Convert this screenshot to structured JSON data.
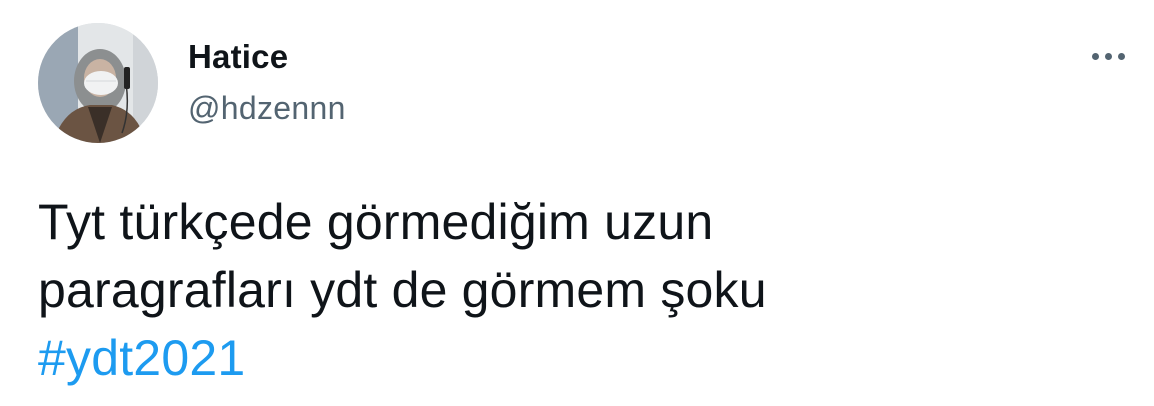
{
  "tweet": {
    "author": {
      "display_name": "Hatice",
      "handle": "@hdzennn"
    },
    "more_icon": "more-horizontal-icon",
    "text_lines": [
      "Tyt türkçede görmediğim uzun",
      "paragrafları ydt de görmem şoku"
    ],
    "hashtag": "#ydt2021"
  },
  "colors": {
    "text_primary": "#0f1419",
    "text_secondary": "#536471",
    "link": "#1d9bf0",
    "background": "#ffffff"
  }
}
